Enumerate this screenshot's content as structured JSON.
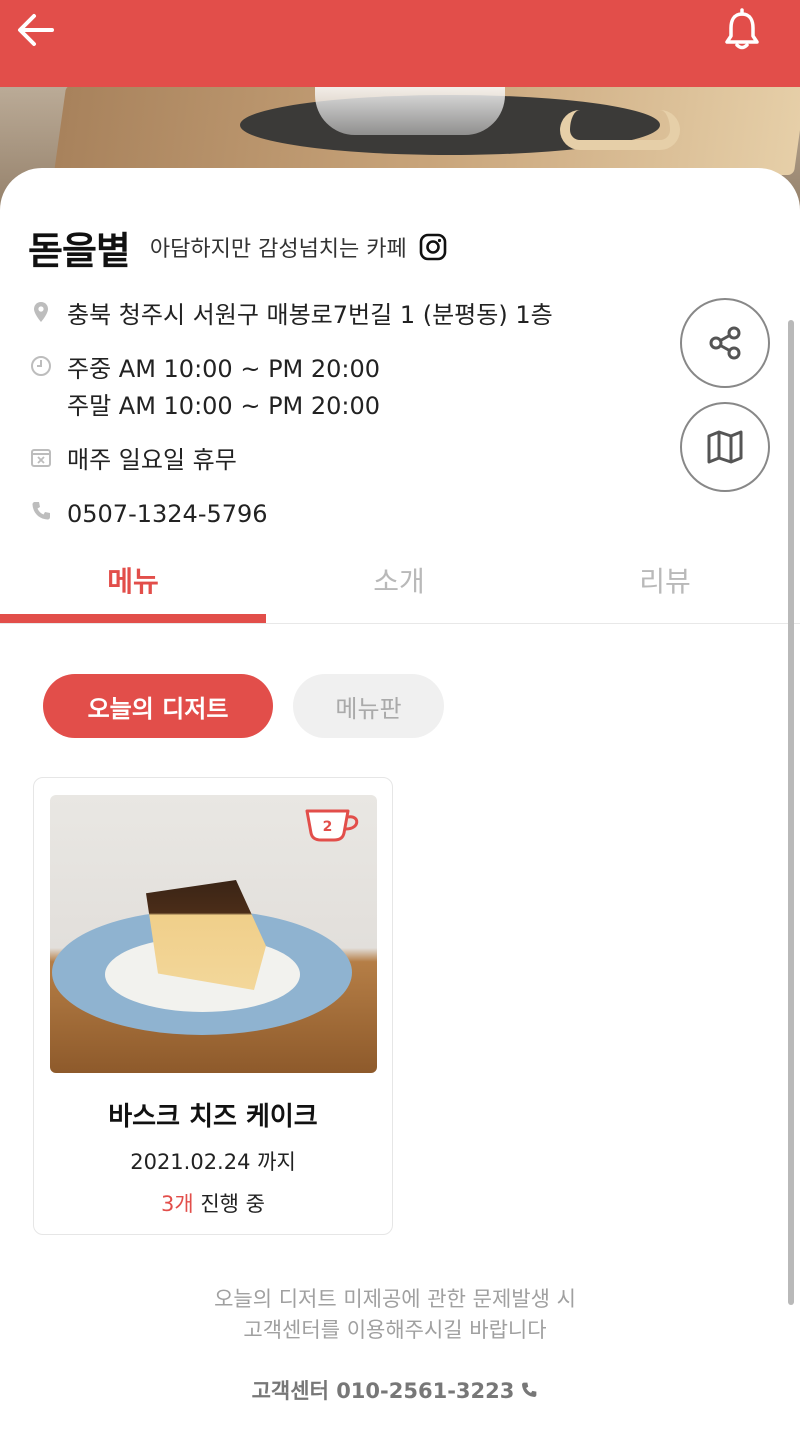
{
  "header": {
    "back_icon": "arrow-left-icon",
    "bell_icon": "bell-icon",
    "color": "#e24e4a"
  },
  "cafe": {
    "name": "돋을볕",
    "description": "아담하지만 감성넘치는 카페",
    "instagram_icon": "instagram-icon",
    "address": "충북 청주시 서원구 매봉로7번길 1 (분평동) 1층",
    "hours_weekday": "주중 AM 10:00 ~ PM 20:00",
    "hours_weekend": "주말 AM 10:00 ~ PM 20:00",
    "closed": "매주 일요일 휴무",
    "phone": "0507-1324-5796"
  },
  "actions": {
    "share_icon": "share-icon",
    "map_icon": "map-icon"
  },
  "tabs": [
    {
      "label": "메뉴",
      "active": true
    },
    {
      "label": "소개",
      "active": false
    },
    {
      "label": "리뷰",
      "active": false
    }
  ],
  "chips": [
    {
      "label": "오늘의 디저트",
      "active": true
    },
    {
      "label": "메뉴판",
      "active": false
    }
  ],
  "dessert_card": {
    "badge_count": "2",
    "title": "바스크 치즈 케이크",
    "date": "2021.02.24 까지",
    "progress_count": "3개",
    "progress_label": " 진행 중"
  },
  "footer": {
    "notice_line1": "오늘의 디저트 미제공에 관한 문제발생 시",
    "notice_line2": "고객센터를 이용해주시길 바랍니다",
    "support": "고객센터 010-2561-3223"
  }
}
